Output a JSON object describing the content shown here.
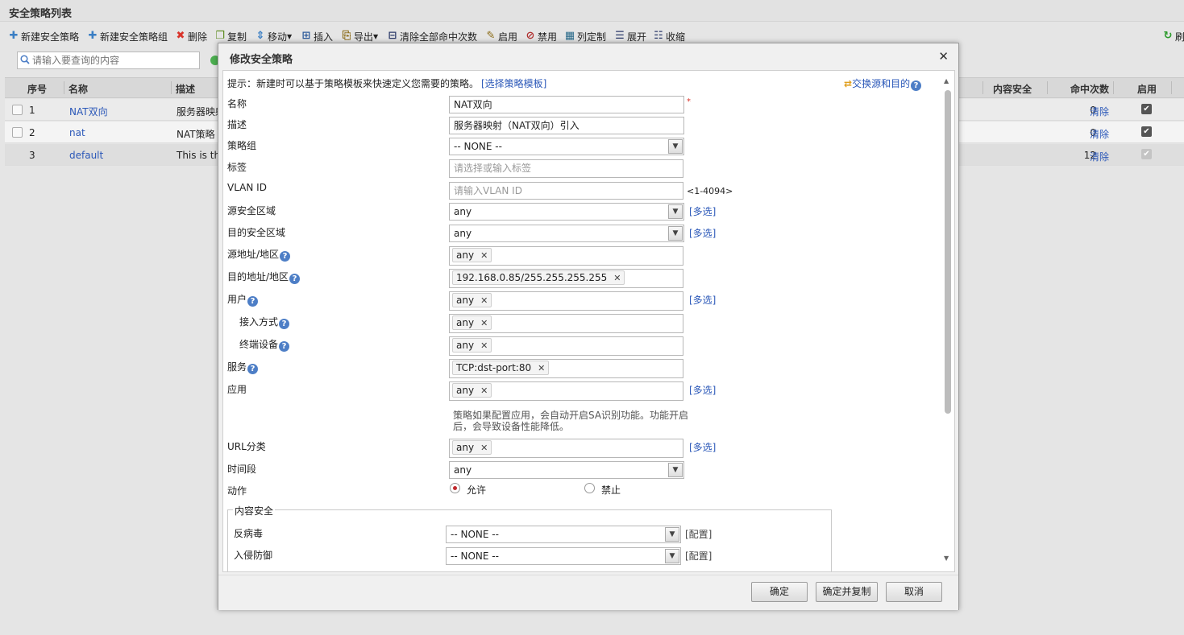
{
  "page": {
    "title": "安全策略列表"
  },
  "toolbar": {
    "new_policy": "新建安全策略",
    "new_group": "新建安全策略组",
    "delete": "删除",
    "copy": "复制",
    "move": "移动",
    "insert": "插入",
    "export": "导出",
    "clear_hits": "清除全部命中次数",
    "enable": "启用",
    "disable": "禁用",
    "columns": "列定制",
    "expand": "展开",
    "collapse": "收缩",
    "refresh": "刷"
  },
  "search": {
    "placeholder": "请输入要查询的内容"
  },
  "table": {
    "headers": {
      "seq": "序号",
      "name": "名称",
      "desc": "描述",
      "content_security": "内容安全",
      "hits": "命中次数",
      "enabled": "启用"
    },
    "rows": [
      {
        "seq": "1",
        "name": "NAT双向",
        "desc": "服务器映射",
        "hits": "0",
        "clear": "清除",
        "enabled": true
      },
      {
        "seq": "2",
        "name": "nat",
        "desc": "NAT策略",
        "hits": "0",
        "clear": "清除",
        "enabled": true
      },
      {
        "seq": "3",
        "name": "default",
        "desc": "This is the",
        "hits": "12",
        "clear": "清除",
        "enabled": true
      }
    ]
  },
  "dialog": {
    "title": "修改安全策略",
    "hint": "提示：新建时可以基于策略模板来快速定义您需要的策略。",
    "template_link": "[选择策略模板]",
    "swap_link": "交换源和目的",
    "fields": {
      "name": {
        "label": "名称",
        "value": "NAT双向",
        "required": "*"
      },
      "desc": {
        "label": "描述",
        "value": "服务器映射（NAT双向）引入"
      },
      "group": {
        "label": "策略组",
        "value": "-- NONE --"
      },
      "tag": {
        "label": "标签",
        "placeholder": "请选择或输入标签"
      },
      "vlan": {
        "label": "VLAN ID",
        "placeholder": "请输入VLAN ID",
        "range": "<1-4094>"
      },
      "src_zone": {
        "label": "源安全区域",
        "value": "any",
        "multi": "[多选]"
      },
      "dst_zone": {
        "label": "目的安全区域",
        "value": "any",
        "multi": "[多选]"
      },
      "src_addr": {
        "label": "源地址/地区",
        "tag": "any"
      },
      "dst_addr": {
        "label": "目的地址/地区",
        "tag": "192.168.0.85/255.255.255.255"
      },
      "user": {
        "label": "用户",
        "tag": "any",
        "multi": "[多选]"
      },
      "access": {
        "label": "接入方式",
        "tag": "any"
      },
      "device": {
        "label": "终端设备",
        "tag": "any"
      },
      "service": {
        "label": "服务",
        "tag": "TCP:dst-port:80"
      },
      "app": {
        "label": "应用",
        "tag": "any",
        "multi": "[多选]",
        "note_line1": "策略如果配置应用，会自动开启SA识别功能。功能开启",
        "note_line2": "后，会导致设备性能降低。"
      },
      "url": {
        "label": "URL分类",
        "tag": "any",
        "multi": "[多选]"
      },
      "time": {
        "label": "时间段",
        "value": "any"
      },
      "action": {
        "label": "动作",
        "allow": "允许",
        "deny": "禁止",
        "selected": "允许"
      }
    },
    "content_security": {
      "legend": "内容安全",
      "antivirus": {
        "label": "反病毒",
        "value": "-- NONE --",
        "config": "[配置]"
      },
      "ips": {
        "label": "入侵防御",
        "value": "-- NONE --",
        "config": "[配置]"
      }
    },
    "buttons": {
      "ok": "确定",
      "ok_copy": "确定并复制",
      "cancel": "取消"
    }
  },
  "colors": {
    "link": "#2a57b8",
    "required": "#d9342b",
    "radio_on": "#c0282d",
    "help": "#4d7ec6"
  }
}
